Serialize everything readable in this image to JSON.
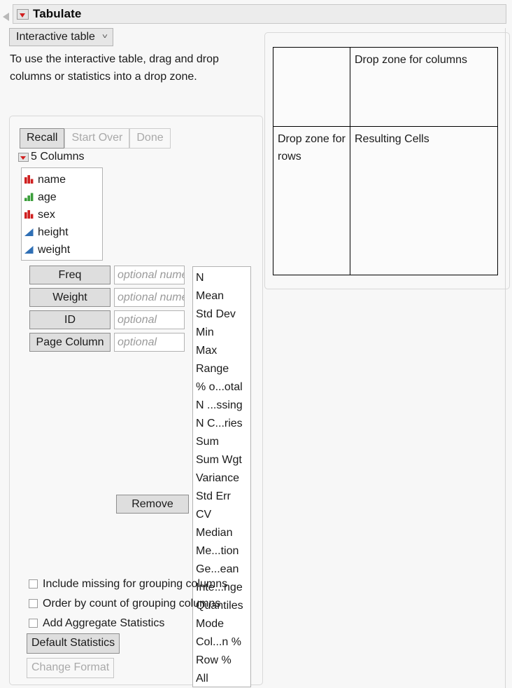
{
  "window": {
    "title": "Tabulate",
    "disclosure_icon": "red-triangle-down-icon",
    "outline_icon": "outline-triangle-icon"
  },
  "mode_select": {
    "value": "Interactive table",
    "chevron_icon": "chevron-down-icon"
  },
  "instructions": "To use the interactive table, drag and drop columns or statistics into a drop zone.",
  "action_buttons": [
    {
      "label": "Recall",
      "enabled": true
    },
    {
      "label": "Start Over",
      "enabled": false
    },
    {
      "label": "Done",
      "enabled": false
    }
  ],
  "columns_section": {
    "header": "5 Columns",
    "disclosure_icon": "red-triangle-down-icon",
    "items": [
      {
        "name": "name",
        "icon": "nominal-red-bars-icon",
        "type": "nominal"
      },
      {
        "name": "age",
        "icon": "ordinal-green-bars-icon",
        "type": "ordinal"
      },
      {
        "name": "sex",
        "icon": "nominal-red-bars-icon",
        "type": "nominal"
      },
      {
        "name": "height",
        "icon": "continuous-blue-triangle-icon",
        "type": "continuous"
      },
      {
        "name": "weight",
        "icon": "continuous-blue-triangle-icon",
        "type": "continuous"
      }
    ]
  },
  "roles": [
    {
      "label": "Freq",
      "placeholder": "optional numeric",
      "value": ""
    },
    {
      "label": "Weight",
      "placeholder": "optional numeric",
      "value": ""
    },
    {
      "label": "ID",
      "placeholder": "optional",
      "value": ""
    },
    {
      "label": "Page Column",
      "placeholder": "optional",
      "value": ""
    }
  ],
  "remove_button": "Remove",
  "statistics": [
    "N",
    "Mean",
    "Std Dev",
    "Min",
    "Max",
    "Range",
    "% o...otal",
    "N ...ssing",
    "N C...ries",
    "Sum",
    "Sum Wgt",
    "Variance",
    "Std Err",
    "CV",
    "Median",
    "Me...tion",
    "Ge...ean",
    "Inte...nge",
    "Quantiles",
    "Mode",
    "Col...n %",
    "Row %",
    "All"
  ],
  "options": [
    {
      "label": "Include missing for grouping columns",
      "checked": false
    },
    {
      "label": "Order by count of grouping columns",
      "checked": false
    },
    {
      "label": "Add Aggregate Statistics",
      "checked": false
    }
  ],
  "bottom_buttons": [
    {
      "label": "Default Statistics",
      "enabled": true
    },
    {
      "label": "Change Format",
      "enabled": false
    }
  ],
  "drop_table": {
    "corner": "",
    "columns_zone": "Drop zone for columns",
    "rows_zone": "Drop zone for rows",
    "cells_zone": "Resulting Cells"
  },
  "colors": {
    "nominal": "#cf2020",
    "ordinal": "#3a9e3a",
    "continuous": "#2f6fb5",
    "panel_bg": "#f8f8f8",
    "titlebar_bg": "#ececec",
    "button_bg": "#dedede"
  }
}
